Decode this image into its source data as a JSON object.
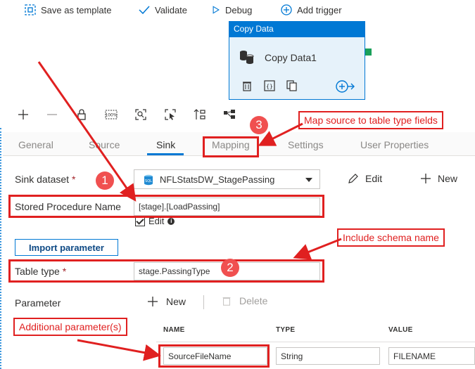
{
  "toolbar": {
    "save_as_template": "Save as template",
    "validate": "Validate",
    "debug": "Debug",
    "add_trigger": "Add trigger"
  },
  "activity": {
    "type_title": "Copy Data",
    "name": "Copy Data1"
  },
  "tabs": [
    {
      "label": "General"
    },
    {
      "label": "Source"
    },
    {
      "label": "Sink"
    },
    {
      "label": "Mapping"
    },
    {
      "label": "Settings"
    },
    {
      "label": "User Properties"
    }
  ],
  "sink": {
    "dataset_label": "Sink dataset",
    "required_mark": "*",
    "dataset_value": "NFLStatsDW_StagePassing",
    "edit_label": "Edit",
    "new_label": "New",
    "sp_label": "Stored Procedure Name",
    "sp_value": "[stage].[LoadPassing]",
    "sp_edit_label": "Edit",
    "import_param_label": "Import parameter",
    "table_type_label": "Table type",
    "table_type_value": "stage.PassingType",
    "parameter_label": "Parameter",
    "param_new_label": "New",
    "param_delete_label": "Delete"
  },
  "param_table": {
    "headers": [
      "NAME",
      "TYPE",
      "VALUE"
    ],
    "row": {
      "name": "SourceFileName",
      "type": "String",
      "value": "FILENAME"
    }
  },
  "annotations": {
    "callout_mapping": "Map source to table type fields",
    "callout_schema": "Include schema name",
    "callout_additional": "Additional parameter(s)",
    "badge_1": "1",
    "badge_2": "2",
    "badge_3": "3"
  },
  "colors": {
    "accent": "#0078d4",
    "annotation_red": "#e02020",
    "port_green": "#1aa05a"
  }
}
